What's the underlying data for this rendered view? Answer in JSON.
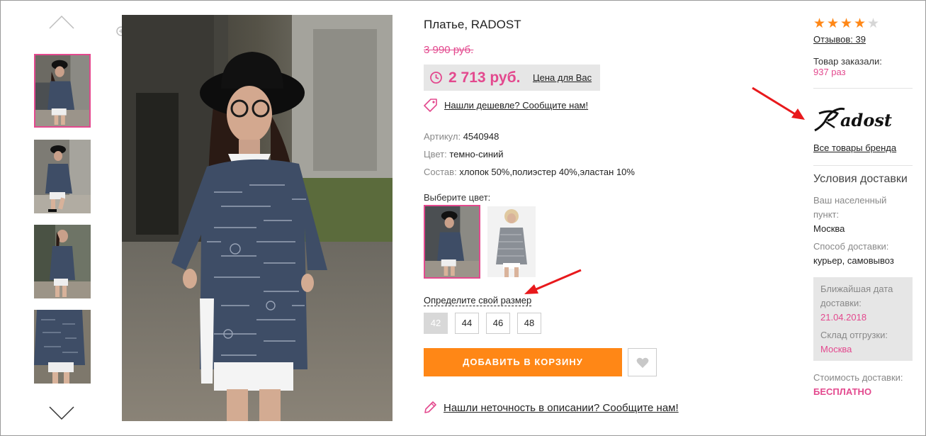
{
  "product": {
    "title": "Платье, RADOST",
    "old_price": "3 990 руб.",
    "price": "2 713 руб.",
    "price_note": "Цена для Вас",
    "cheaper_link": "Нашли дешевле? Сообщите нам!",
    "properties": [
      {
        "label": "Артикул:",
        "value": "4540948"
      },
      {
        "label": "Цвет:",
        "value": "темно-синий"
      },
      {
        "label": "Состав:",
        "value": "хлопок 50%,полиэстер 40%,эластан 10%"
      }
    ],
    "color_label": "Выберите цвет:",
    "size_link": "Определите свой размер",
    "sizes": [
      "42",
      "44",
      "46",
      "48"
    ],
    "selected_size": "42",
    "add_to_cart": "ДОБАВИТЬ В КОРЗИНУ",
    "report_link": "Нашли неточность в описании? Сообщите нам!"
  },
  "sidebar": {
    "rating": 4,
    "rating_max": 5,
    "reviews": "Отзывов: 39",
    "ordered_label": "Товар заказали:",
    "ordered_value": "937 раз",
    "brand_logo": "Radost",
    "brand_link": "Все товары бренда",
    "delivery_title": "Условия доставки",
    "locality_label": "Ваш населенный пункт:",
    "locality_value": "Москва",
    "method_label": "Способ доставки:",
    "method_value": "курьер, самовывоз",
    "nearest_label": "Ближайшая дата доставки:",
    "nearest_value": "21.04.2018",
    "warehouse_label": "Склад отгрузки:",
    "warehouse_value": "Москва",
    "cost_label": "Стоимость доставки:",
    "cost_value": "БЕСПЛАТНО"
  },
  "icons": {
    "zoom": "magnifier-plus-icon",
    "price": "clock-icon",
    "cheaper": "price-tag-icon",
    "favorite": "heart-icon",
    "report": "pencil-icon",
    "gallery_prev": "chevron-up-icon",
    "gallery_next": "chevron-down-icon"
  },
  "colors": {
    "accent_pink": "#e3498e",
    "button_orange": "#ff8716",
    "star_orange": "#ff8716",
    "annotation_red": "#e8191c"
  }
}
